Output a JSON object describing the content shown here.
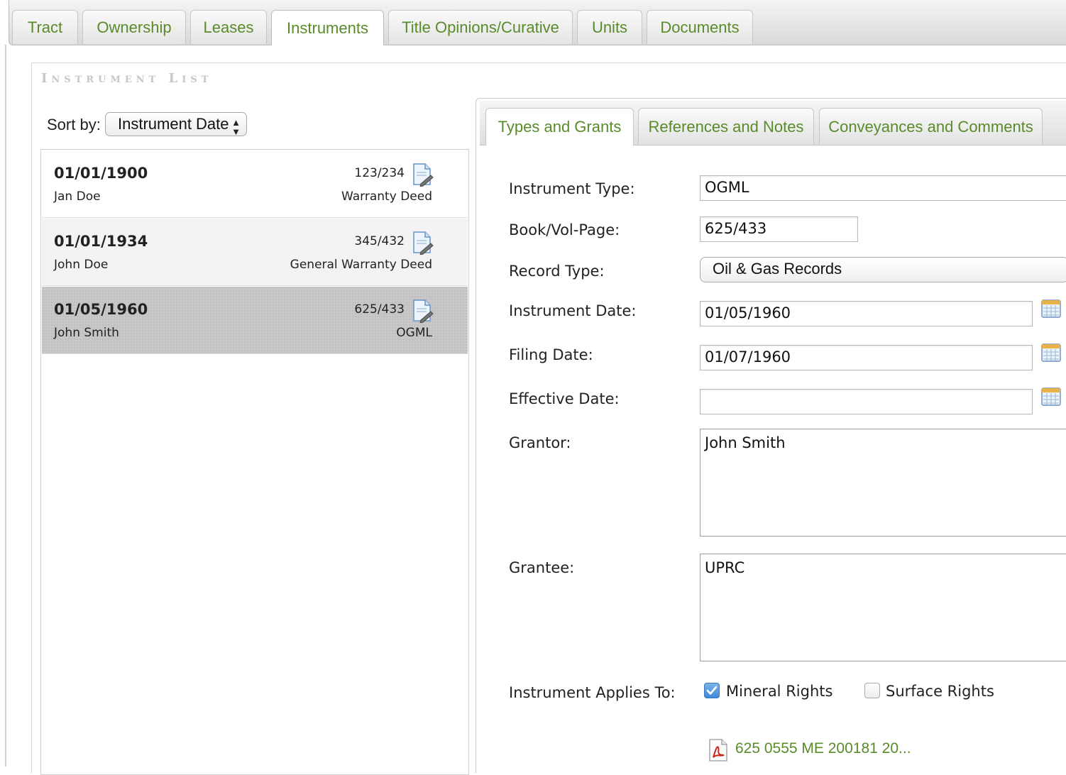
{
  "top_tabs": [
    {
      "label": "Tract"
    },
    {
      "label": "Ownership"
    },
    {
      "label": "Leases"
    },
    {
      "label": "Instruments"
    },
    {
      "label": "Title Opinions/Curative"
    },
    {
      "label": "Units"
    },
    {
      "label": "Documents"
    }
  ],
  "active_top_tab": "Instruments",
  "instrument_list": {
    "title": "Instrument List",
    "sort_label": "Sort by:",
    "sort_value": "Instrument Date",
    "rows": [
      {
        "date": "01/01/1900",
        "name": "Jan Doe",
        "book_page": "123/234",
        "type": "Warranty Deed",
        "icon": "document-edit-icon"
      },
      {
        "date": "01/01/1934",
        "name": "John Doe",
        "book_page": "345/432",
        "type": "General Warranty Deed",
        "icon": "document-edit-icon"
      },
      {
        "date": "01/05/1960",
        "name": "John Smith",
        "book_page": "625/433",
        "type": "OGML",
        "icon": "document-edit-icon"
      }
    ],
    "selected_row": 2
  },
  "detail_tabs": [
    {
      "label": "Types and Grants"
    },
    {
      "label": "References and Notes"
    },
    {
      "label": "Conveyances and Comments"
    }
  ],
  "active_detail_tab": "Types and Grants",
  "form": {
    "instrument_type": {
      "label": "Instrument Type:",
      "value": "OGML"
    },
    "book_vol_page": {
      "label": "Book/Vol-Page:",
      "value": "625/433"
    },
    "record_type": {
      "label": "Record Type:",
      "value": "Oil & Gas Records"
    },
    "instrument_date": {
      "label": "Instrument Date:",
      "value": "01/05/1960"
    },
    "filing_date": {
      "label": "Filing Date:",
      "value": "01/07/1960"
    },
    "effective_date": {
      "label": "Effective Date:",
      "value": ""
    },
    "grantor": {
      "label": "Grantor:",
      "value": "John Smith"
    },
    "grantee": {
      "label": "Grantee:",
      "value": "UPRC"
    },
    "applies_to": {
      "label": "Instrument Applies To:",
      "mineral_rights": {
        "label": "Mineral Rights",
        "checked": true
      },
      "surface_rights": {
        "label": "Surface Rights",
        "checked": false
      }
    },
    "attachment": {
      "label": "625 0555 ME 200181 20...",
      "icon": "pdf-icon"
    }
  },
  "colors": {
    "tab_text": "#5a8b2a",
    "checkbox_checked": "#4a8fdb",
    "selected_row": "#c8c8c8"
  }
}
